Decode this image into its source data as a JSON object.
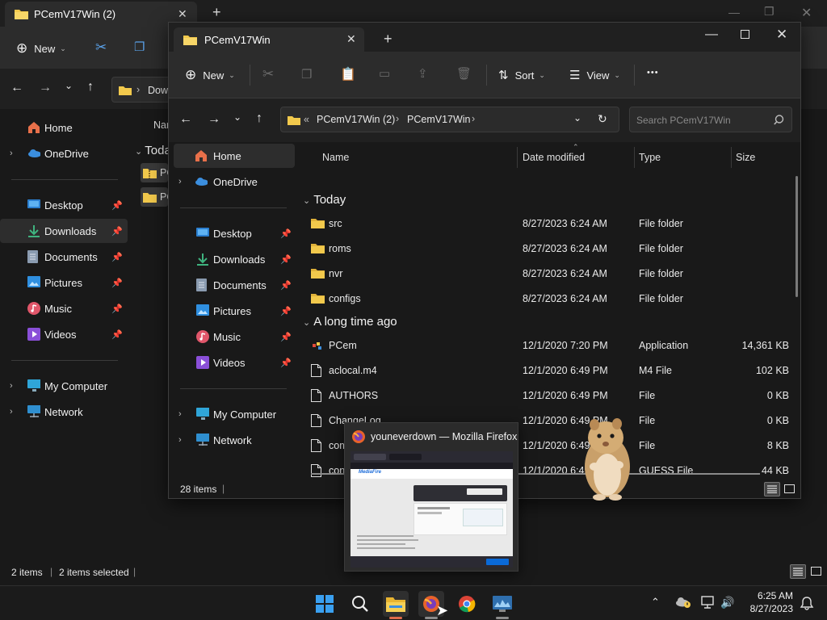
{
  "colors": {
    "accent": "#4aa3f0",
    "folder": "#f2c94c",
    "firefox": "#e8632a"
  },
  "back_window": {
    "tab_title": "PCemV17Win (2)",
    "toolbar": {
      "new_label": "New"
    },
    "address_fragment": "Dow",
    "col_name_fragment": "Nar",
    "group_fragment": "Toda",
    "file_fragments": [
      "PC",
      "PC"
    ],
    "nav": [
      {
        "label": "Home",
        "icon": "home-icon"
      },
      {
        "label": "OneDrive",
        "icon": "cloud-icon"
      },
      {
        "label": "Desktop",
        "icon": "desktop-icon"
      },
      {
        "label": "Downloads",
        "icon": "download-icon"
      },
      {
        "label": "Documents",
        "icon": "document-icon"
      },
      {
        "label": "Pictures",
        "icon": "pictures-icon"
      },
      {
        "label": "Music",
        "icon": "music-icon"
      },
      {
        "label": "Videos",
        "icon": "videos-icon"
      },
      {
        "label": "My Computer",
        "icon": "computer-icon"
      },
      {
        "label": "Network",
        "icon": "network-icon"
      }
    ],
    "status": {
      "items": "2 items",
      "selected": "2 items selected"
    }
  },
  "front_window": {
    "tab_title": "PCemV17Win",
    "toolbar": {
      "new_label": "New",
      "sort_label": "Sort",
      "view_label": "View",
      "more_label": "•••"
    },
    "breadcrumb": {
      "prefix": "«",
      "crumbs": [
        "PCemV17Win (2)",
        "PCemV17Win"
      ]
    },
    "search": {
      "placeholder": "Search PCemV17Win"
    },
    "nav": [
      {
        "label": "Home",
        "icon": "home-icon"
      },
      {
        "label": "OneDrive",
        "icon": "cloud-icon"
      },
      {
        "label": "Desktop",
        "icon": "desktop-icon"
      },
      {
        "label": "Downloads",
        "icon": "download-icon"
      },
      {
        "label": "Documents",
        "icon": "document-icon"
      },
      {
        "label": "Pictures",
        "icon": "pictures-icon"
      },
      {
        "label": "Music",
        "icon": "music-icon"
      },
      {
        "label": "Videos",
        "icon": "videos-icon"
      },
      {
        "label": "My Computer",
        "icon": "computer-icon"
      },
      {
        "label": "Network",
        "icon": "network-icon"
      }
    ],
    "columns": {
      "name": "Name",
      "date": "Date modified",
      "type": "Type",
      "size": "Size"
    },
    "groups": [
      {
        "label": "Today",
        "files": [
          {
            "name": "src",
            "date": "8/27/2023 6:24 AM",
            "type": "File folder",
            "size": "",
            "icon": "folder-icon"
          },
          {
            "name": "roms",
            "date": "8/27/2023 6:24 AM",
            "type": "File folder",
            "size": "",
            "icon": "folder-icon"
          },
          {
            "name": "nvr",
            "date": "8/27/2023 6:24 AM",
            "type": "File folder",
            "size": "",
            "icon": "folder-icon"
          },
          {
            "name": "configs",
            "date": "8/27/2023 6:24 AM",
            "type": "File folder",
            "size": "",
            "icon": "folder-icon"
          }
        ]
      },
      {
        "label": "A long time ago",
        "files": [
          {
            "name": "PCem",
            "date": "12/1/2020 7:20 PM",
            "type": "Application",
            "size": "14,361 KB",
            "icon": "app-icon"
          },
          {
            "name": "aclocal.m4",
            "date": "12/1/2020 6:49 PM",
            "type": "M4 File",
            "size": "102 KB",
            "icon": "file-icon"
          },
          {
            "name": "AUTHORS",
            "date": "12/1/2020 6:49 PM",
            "type": "File",
            "size": "0 KB",
            "icon": "file-icon"
          },
          {
            "name": "ChangeLog",
            "date": "12/1/2020 6:49 PM",
            "type": "File",
            "size": "0 KB",
            "icon": "file-icon"
          },
          {
            "name": "compil",
            "date": "12/1/2020 6:49 PM",
            "type": "File",
            "size": "8 KB",
            "icon": "file-icon"
          },
          {
            "name": "con",
            "date": "12/1/2020 6:49",
            "type": "GUESS File",
            "size": "44 KB",
            "icon": "file-icon"
          }
        ]
      }
    ],
    "status": {
      "items": "28 items"
    }
  },
  "preview": {
    "title": "youneverdown — Mozilla Firefox",
    "thumb_brand": "MediaFire"
  },
  "taskbar": {
    "time": "6:25 AM",
    "date": "8/27/2023"
  }
}
